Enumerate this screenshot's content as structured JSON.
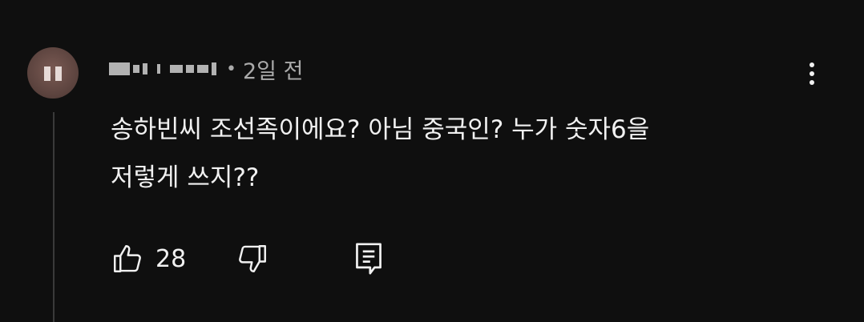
{
  "comment": {
    "time": "2일 전",
    "text_lines": [
      "송하빈씨 조선족이에요? 아님 중국인? 누가 숫자6을",
      "저렇게 쓰지??"
    ],
    "like_count": "28"
  },
  "icons": {
    "menu": "more-vert-icon",
    "like": "thumb-up-icon",
    "dislike": "thumb-down-icon",
    "reply": "reply-comment-icon"
  },
  "colors": {
    "background": "#0f0f0f",
    "text": "#f1f1f1",
    "secondary": "#aaaaaa",
    "avatar": "#6b4f49"
  }
}
